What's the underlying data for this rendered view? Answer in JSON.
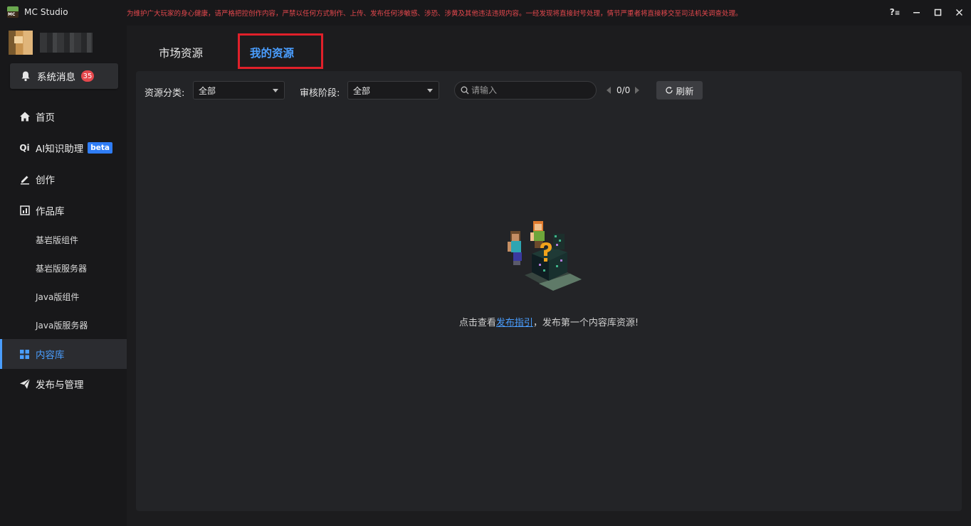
{
  "titlebar": {
    "app_name": "MC Studio",
    "notice": "为维护广大玩家的身心健康，请严格把控创作内容，严禁以任何方式制作、上传、发布任何涉敏感、涉恐、涉黄及其他违法违规内容。一经发现将直接封号处理，情节严重者将直接移交至司法机关调查处理。",
    "help_glyph": "?",
    "notice_color": "#e5484d"
  },
  "sidebar": {
    "system_message": {
      "label": "系统消息",
      "count": "35"
    },
    "items": [
      {
        "label": "首页",
        "icon": "home-icon"
      },
      {
        "label": "AI知识助理",
        "icon": "ai-icon",
        "badge": "beta"
      },
      {
        "label": "创作",
        "icon": "edit-icon"
      },
      {
        "label": "作品库",
        "icon": "library-icon"
      }
    ],
    "sub_items": [
      "基岩版组件",
      "基岩版服务器",
      "Java版组件",
      "Java版服务器"
    ],
    "bottom_items": [
      {
        "label": "内容库",
        "icon": "grid-icon",
        "active": true
      },
      {
        "label": "发布与管理",
        "icon": "paper-plane-icon"
      }
    ],
    "ai_icon_text": "Qi",
    "accent_color": "#4a9eff"
  },
  "main": {
    "tabs": [
      {
        "label": "市场资源",
        "active": false
      },
      {
        "label": "我的资源",
        "active": true
      }
    ],
    "filters": {
      "category_label": "资源分类:",
      "category_value": "全部",
      "review_label": "审核阶段:",
      "review_value": "全部",
      "search_placeholder": "请输入",
      "pager": "0/0",
      "refresh_label": "刷新"
    },
    "empty": {
      "prefix": "点击查看",
      "link": "发布指引",
      "suffix": "，发布第一个内容库资源!"
    }
  }
}
